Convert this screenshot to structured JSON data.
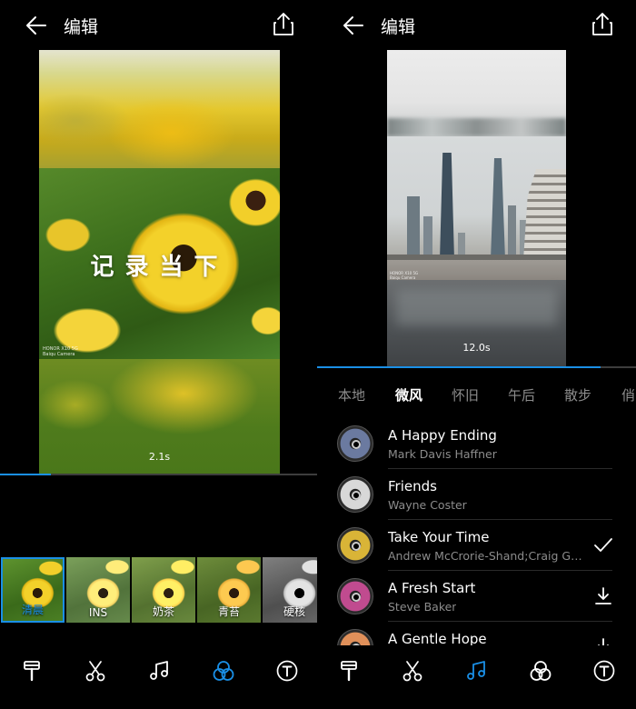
{
  "left": {
    "header": {
      "title": "编辑"
    },
    "preview": {
      "overlay_text": "记录当下",
      "camera_caption": "HONOR X10 5G\nBaiqu Camera",
      "duration": "2.1s",
      "progress": 0.16
    },
    "filters": [
      {
        "label": "清晨",
        "selected": true
      },
      {
        "label": "INS",
        "selected": false
      },
      {
        "label": "奶茶",
        "selected": false
      },
      {
        "label": "青苔",
        "selected": false
      },
      {
        "label": "硬核",
        "selected": false
      }
    ],
    "toolbar": {
      "active": "filter"
    }
  },
  "right": {
    "header": {
      "title": "编辑"
    },
    "preview": {
      "camera_caption": "HONOR X10 5G\nBaiqu Camera",
      "duration": "12.0s",
      "progress": 0.89
    },
    "music_tabs": [
      {
        "label": "本地",
        "active": false
      },
      {
        "label": "微风",
        "active": true
      },
      {
        "label": "怀旧",
        "active": false
      },
      {
        "label": "午后",
        "active": false
      },
      {
        "label": "散步",
        "active": false
      },
      {
        "label": "俏",
        "active": false
      }
    ],
    "tracks": [
      {
        "title": "A Happy Ending",
        "artist": "Mark Davis Haffner",
        "action": "none",
        "disc_color": "#6b7aa0"
      },
      {
        "title": "Friends",
        "artist": "Wayne Coster",
        "action": "none",
        "disc_color": "#d8d8d8"
      },
      {
        "title": "Take Your Time",
        "artist": "Andrew McCrorie-Shand;Craig Ga...",
        "action": "selected",
        "disc_color": "#d9b437"
      },
      {
        "title": "A Fresh Start",
        "artist": "Steve  Baker",
        "action": "download",
        "disc_color": "#c04b8f"
      },
      {
        "title": "A Gentle Hope",
        "artist": "",
        "action": "download",
        "disc_color": "#e0905a"
      }
    ],
    "toolbar": {
      "active": "music"
    }
  },
  "colors": {
    "accent": "#1a8fe6",
    "muted": "#8c8c8c"
  },
  "icons": {
    "back": "arrow-left-icon",
    "share": "share-icon",
    "tools": [
      "theme-brush-icon",
      "scissors-icon",
      "music-note-icon",
      "filter-circles-icon",
      "text-icon"
    ]
  }
}
